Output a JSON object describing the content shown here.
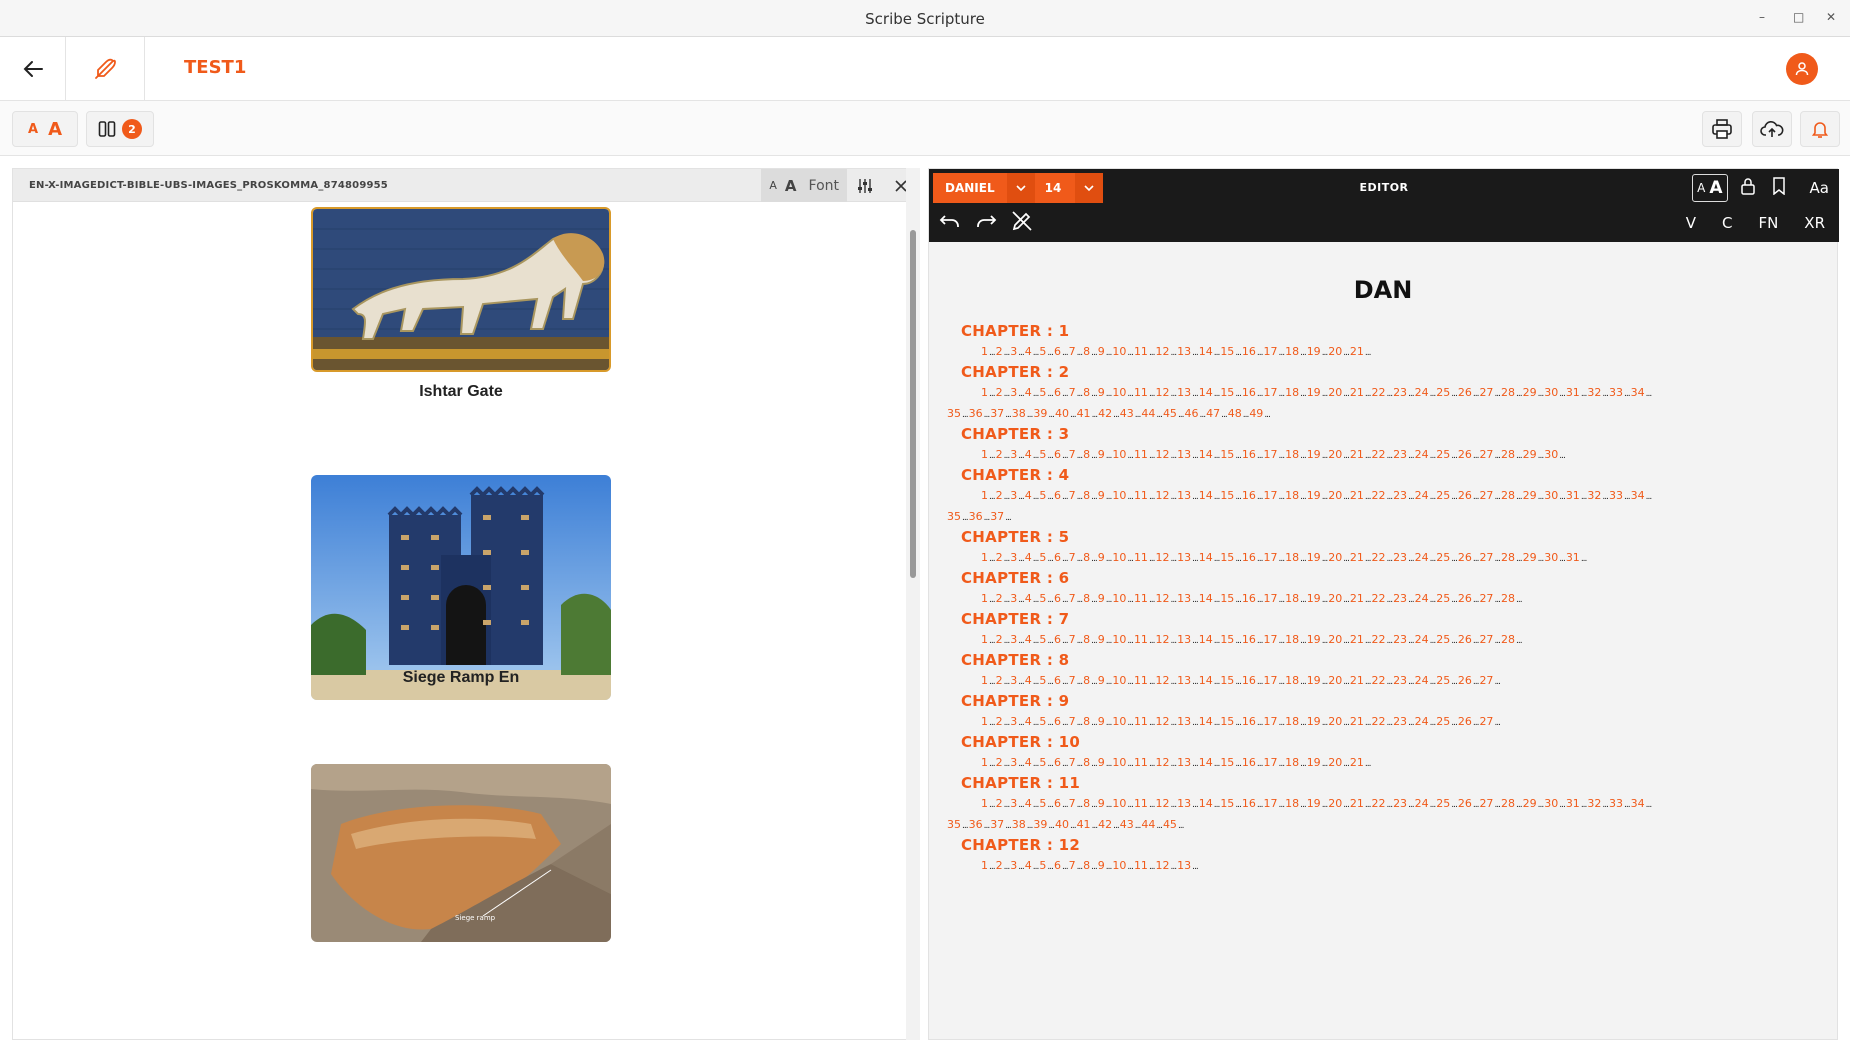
{
  "window": {
    "title": "Scribe Scripture"
  },
  "appbar": {
    "project": "TEST1"
  },
  "toolbar": {
    "font_small": "A",
    "font_big": "A",
    "panes_count": "2"
  },
  "resource": {
    "name": "EN-X-IMAGEDICT-BIBLE-UBS-IMAGES_PROSKOMMA_874809955",
    "font_small": "A",
    "font_big": "A",
    "font_label": "Font",
    "items": [
      {
        "caption": "Ishtar Gate"
      },
      {
        "caption": "Siege Ramp En"
      }
    ],
    "image_label": "Siege ramp"
  },
  "editor": {
    "book": "DANIEL",
    "chapter": "14",
    "title": "EDITOR",
    "aa_small": "A",
    "aa_big": "A",
    "aa_label": "Aa",
    "modes": [
      "V",
      "C",
      "FN",
      "XR"
    ],
    "book_heading": "DAN",
    "chapter_prefix": "CHAPTER : ",
    "chapters": [
      {
        "num": "1",
        "verses": 21
      },
      {
        "num": "2",
        "verses": 49
      },
      {
        "num": "3",
        "verses": 30
      },
      {
        "num": "4",
        "verses": 37
      },
      {
        "num": "5",
        "verses": 31
      },
      {
        "num": "6",
        "verses": 28
      },
      {
        "num": "7",
        "verses": 28
      },
      {
        "num": "8",
        "verses": 27
      },
      {
        "num": "9",
        "verses": 27
      },
      {
        "num": "10",
        "verses": 21
      },
      {
        "num": "11",
        "verses": 45
      },
      {
        "num": "12",
        "verses": 13
      }
    ]
  },
  "colors": {
    "accent": "#f05a1a",
    "editor_header": "#1a1a1a"
  }
}
